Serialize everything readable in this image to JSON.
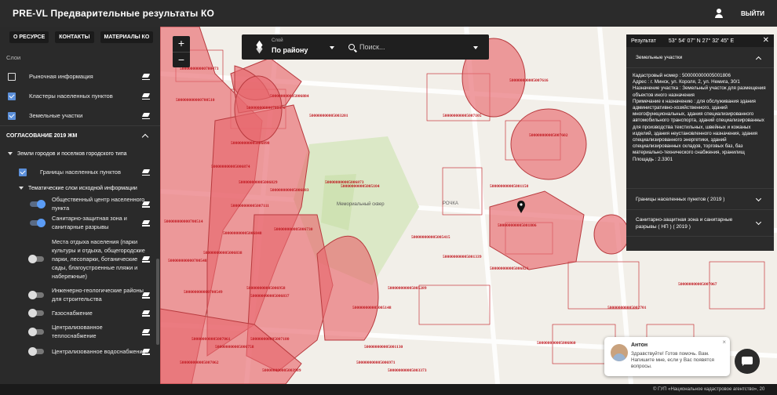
{
  "app": {
    "title": "PRE-VL Предварительные результаты КО",
    "logout_label": "ВЫЙТИ"
  },
  "sidebar": {
    "buttons": [
      "О РЕСУРСЕ",
      "КОНТАКТЫ",
      "МАТЕРИАЛЫ КО"
    ],
    "layers_heading": "Слои",
    "layers": [
      {
        "label": "Рыночная информация",
        "checked": false
      },
      {
        "label": "Кластеры населенных пунктов",
        "checked": true
      },
      {
        "label": "Земельные участки",
        "checked": true
      }
    ],
    "section_title": "СОГЛАСОВАНИЕ 2019 ЖМ",
    "subgroup_title": "Земли городов и поселков городского типа",
    "subgroup_layer": {
      "label": "Границы населенных пунктов",
      "checked": true
    },
    "theme_group_title": "Тематические слои исходной информации",
    "theme_layers": [
      {
        "label": "Общественный центр населенного пункта",
        "on": true
      },
      {
        "label": "Санитарно-защитная зона и санитарные разрывы",
        "on": true
      },
      {
        "label": "Места отдыха населения (парки культуры и отдыха, общегородские парки, лесопарки, ботанические сады, благоустроенные пляжи и набережные)",
        "on": false
      },
      {
        "label": "Инженерно-геологические районы для строительства",
        "on": false
      },
      {
        "label": "Газоснабжение",
        "on": false
      },
      {
        "label": "Централизованное теплоснабжение",
        "on": false
      },
      {
        "label": "Централизованное водоснабжение",
        "on": false
      }
    ]
  },
  "map": {
    "zoom_in": "+",
    "zoom_out": "−",
    "layer_caption": "Слой",
    "layer_value": "По району",
    "search_placeholder": "Поиск...",
    "parcel_labels": [
      "500000000000700473",
      "500000000000700510",
      "500000000000700514",
      "500000000000700548",
      "500000000000700549",
      "500000000000700470",
      "500000000005006884",
      "500000000005006898",
      "500000000005006874",
      "500000000005006829",
      "500000000005006883",
      "500000000005006848",
      "500000000005006838",
      "500000000005007111",
      "500000000005006837",
      "500000000005005104",
      "500000000005006730",
      "500000000005006958",
      "500000000005007180",
      "500000000005007061",
      "500000000005007062",
      "500000000005003201",
      "500000000005006873",
      "500000000005005415",
      "500000000005007105",
      "500000000005005148",
      "500000000005005289",
      "500000000005003373",
      "500000000005006971",
      "500000000005007616",
      "500000000005007701",
      "500000000005007602",
      "500000000005001806",
      "500000000005001150",
      "500000000005002701",
      "500000000005001339",
      "500000000005007067",
      "500000000005001130",
      "500000000005006821",
      "500000000005003989",
      "500000000005006758",
      "500000000005006860"
    ],
    "place_labels": [
      "Мемориальный сквер",
      "РОЧКА"
    ]
  },
  "result_panel": {
    "title": "Результат",
    "coords": "53° 54' 07\" N 27° 32' 45\" E",
    "sections": [
      {
        "title": "Земельные участки",
        "expanded": true,
        "body": [
          "Кадастровый номер : 500000000005001806",
          "Адрес : г. Минск, ул. Короля, 2, ул. Немига, 30/1",
          "Назначение участка : Земельный участок для размещения объектов иного назначения",
          "Примечание к назначению : для обслуживания здания административно-хозяйственного, зданий многофункциональных, здания специализированного автомобильного транспорта, зданий специализированных для производства текстильных, швейных и кожаных изделий, здания неустановленного назначения, здания специализированного энергетики, зданий специализированных складов, торговых баз, баз материально-технического снабжения, хранилищ",
          "Площадь : 2.3301"
        ]
      },
      {
        "title": "Границы населенных пунктов ( 2019 )",
        "expanded": false
      },
      {
        "title": "Санитарно-защитная зона и санитарные разрывы ( НП ) ( 2019 )",
        "expanded": false
      }
    ]
  },
  "chat": {
    "name": "Антон",
    "message": "Здравствуйте! Готов помочь. Вам. Напишите мне, если у Вас появятся вопросы.",
    "close": "×"
  },
  "footer": {
    "text": "© ГУП «Национальное кадастровое агентство», 20"
  },
  "colors": {
    "topbar": "#2b2b2b",
    "sidebar": "#2a2a2a",
    "accent_blue": "#5b8fd9",
    "zone_red": "#e8686e",
    "parcel_label": "#c0161e"
  }
}
